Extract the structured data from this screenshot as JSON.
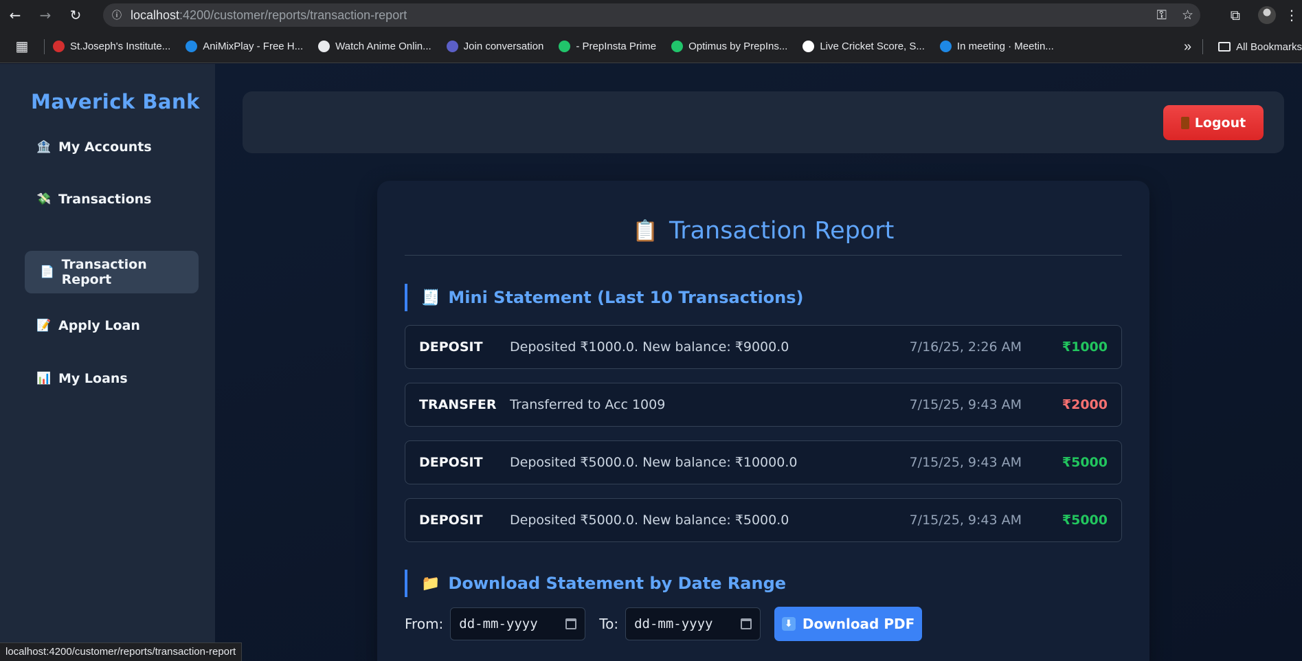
{
  "browser": {
    "url_host": "localhost",
    "url_path": ":4200/customer/reports/transaction-report",
    "status_url": "localhost:4200/customer/reports/transaction-report",
    "bookmarks": [
      {
        "label": "St.Joseph's Institute...",
        "color": "#d32f2f"
      },
      {
        "label": "AniMixPlay - Free H...",
        "color": "#1e88e5"
      },
      {
        "label": "Watch Anime Onlin...",
        "color": "#e8eaed"
      },
      {
        "label": "Join conversation",
        "color": "#5b5fc7"
      },
      {
        "label": "- PrepInsta Prime",
        "color": "#21c46b"
      },
      {
        "label": "Optimus by PrepIns...",
        "color": "#21c46b"
      },
      {
        "label": "Live Cricket Score, S...",
        "color": "#ffffff"
      },
      {
        "label": "In meeting · Meetin...",
        "color": "#1e88e5"
      }
    ],
    "all_bookmarks": "All Bookmarks"
  },
  "sidebar": {
    "brand": "Maverick Bank",
    "items": [
      {
        "icon": "🏦",
        "label": "My Accounts"
      },
      {
        "icon": "💸",
        "label": "Transactions"
      },
      {
        "icon": "📄",
        "label": "Transaction Report"
      },
      {
        "icon": "📝",
        "label": "Apply Loan"
      },
      {
        "icon": "📊",
        "label": "My Loans"
      }
    ]
  },
  "topbar": {
    "logout_label": "Logout"
  },
  "report": {
    "title_icon": "📋",
    "title": "Transaction Report",
    "mini_icon": "🧾",
    "mini_heading": "Mini Statement (Last 10 Transactions)",
    "transactions": [
      {
        "type": "DEPOSIT",
        "description": "Deposited ₹1000.0. New balance: ₹9000.0",
        "date": "7/16/25, 2:26 AM",
        "amount": "₹1000",
        "direction": "in"
      },
      {
        "type": "TRANSFER",
        "description": "Transferred to Acc 1009",
        "date": "7/15/25, 9:43 AM",
        "amount": "₹2000",
        "direction": "out"
      },
      {
        "type": "DEPOSIT",
        "description": "Deposited ₹5000.0. New balance: ₹10000.0",
        "date": "7/15/25, 9:43 AM",
        "amount": "₹5000",
        "direction": "in"
      },
      {
        "type": "DEPOSIT",
        "description": "Deposited ₹5000.0. New balance: ₹5000.0",
        "date": "7/15/25, 9:43 AM",
        "amount": "₹5000",
        "direction": "in"
      }
    ],
    "download_icon": "📁",
    "download_heading": "Download Statement by Date Range",
    "from_label": "From:",
    "to_label": "To:",
    "date_placeholder": "dd-mm-yyyy",
    "download_button": "Download PDF"
  },
  "colors": {
    "accent": "#60a5fa",
    "credit": "#22c55e",
    "debit": "#f87171",
    "logout": "#ef4444"
  }
}
